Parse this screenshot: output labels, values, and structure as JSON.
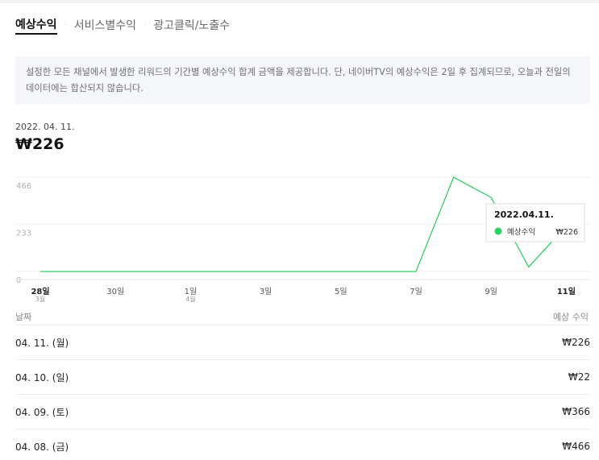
{
  "tabs": [
    {
      "label": "예상수익",
      "active": true
    },
    {
      "label": "서비스별수익",
      "active": false
    },
    {
      "label": "광고클릭/노출수",
      "active": false
    }
  ],
  "tab_separator": "·",
  "notice": "설정한 모든 채널에서 발생한 리워드의 기간별 예상수익 합계 금액을 제공합니다. 단, 네이버TV의 예상수익은 2일 후 집계되므로, 오늘과 전일의 데이터에는 합산되지 않습니다.",
  "selected": {
    "date": "2022. 04. 11.",
    "total": "₩226"
  },
  "chart_data": {
    "type": "line",
    "x": [
      "03-28",
      "03-29",
      "03-30",
      "03-31",
      "04-01",
      "04-02",
      "04-03",
      "04-04",
      "04-05",
      "04-06",
      "04-07",
      "04-08",
      "04-09",
      "04-10",
      "04-11"
    ],
    "series": [
      {
        "name": "예상수익",
        "values": [
          0,
          0,
          0,
          0,
          0,
          0,
          0,
          0,
          0,
          0,
          0,
          466,
          366,
          22,
          226
        ]
      }
    ],
    "ylim": [
      0,
      466
    ],
    "yticks": [
      "466",
      "233",
      "0"
    ],
    "xticks": [
      {
        "x": "03-28",
        "label": "28일",
        "sub": "3월",
        "bold": true
      },
      {
        "x": "03-30",
        "label": "30일",
        "sub": "",
        "bold": false
      },
      {
        "x": "04-01",
        "label": "1일",
        "sub": "4월",
        "bold": false
      },
      {
        "x": "04-03",
        "label": "3일",
        "sub": "",
        "bold": false
      },
      {
        "x": "04-05",
        "label": "5일",
        "sub": "",
        "bold": false
      },
      {
        "x": "04-07",
        "label": "7일",
        "sub": "",
        "bold": false
      },
      {
        "x": "04-09",
        "label": "9일",
        "sub": "",
        "bold": false
      },
      {
        "x": "04-11",
        "label": "11일",
        "sub": "",
        "bold": true
      }
    ],
    "grid": true,
    "line_color": "#2fcf63",
    "tooltip": {
      "date": "2022.04.11.",
      "series": "예상수익",
      "value": "₩226"
    }
  },
  "table": {
    "headers": {
      "date": "날짜",
      "amount": "예상 수익"
    },
    "rows": [
      {
        "date": "04. 11. (월)",
        "amount": "₩226"
      },
      {
        "date": "04. 10. (일)",
        "amount": "₩22"
      },
      {
        "date": "04. 09. (토)",
        "amount": "₩366"
      },
      {
        "date": "04. 08. (금)",
        "amount": "₩466"
      }
    ]
  }
}
